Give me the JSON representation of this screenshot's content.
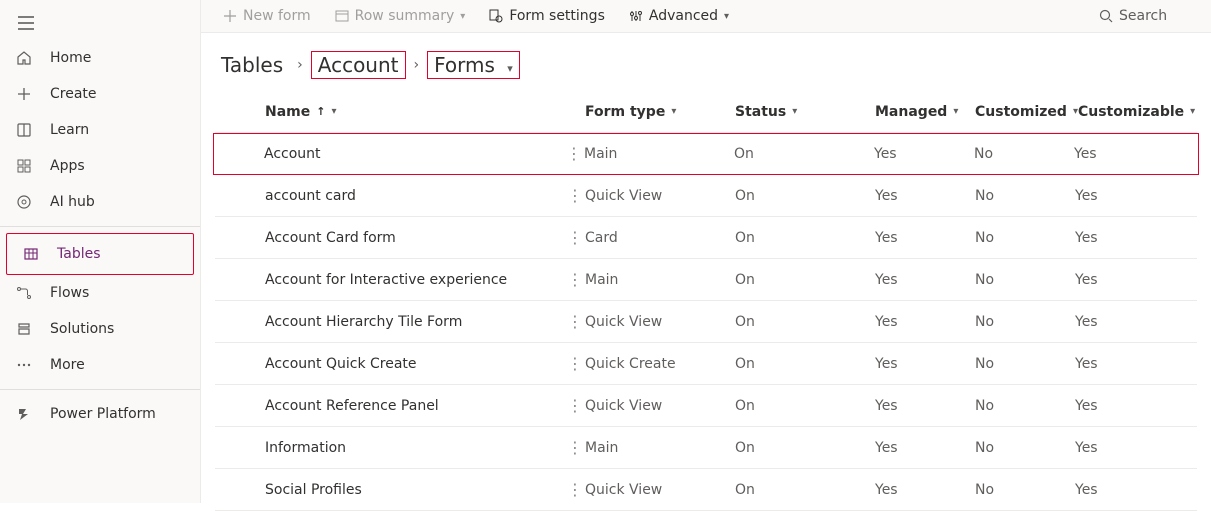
{
  "sidebar": {
    "items": [
      {
        "id": "home",
        "label": "Home"
      },
      {
        "id": "create",
        "label": "Create"
      },
      {
        "id": "learn",
        "label": "Learn"
      },
      {
        "id": "apps",
        "label": "Apps"
      },
      {
        "id": "aihub",
        "label": "AI hub"
      },
      {
        "id": "tables",
        "label": "Tables"
      },
      {
        "id": "flows",
        "label": "Flows"
      },
      {
        "id": "solutions",
        "label": "Solutions"
      },
      {
        "id": "more",
        "label": "More"
      },
      {
        "id": "powerplatform",
        "label": "Power Platform"
      }
    ]
  },
  "commandBar": {
    "newForm": "New form",
    "rowSummary": "Row summary",
    "formSettings": "Form settings",
    "advanced": "Advanced",
    "searchPlaceholder": "Search"
  },
  "breadcrumb": {
    "root": "Tables",
    "level1": "Account",
    "level2": "Forms"
  },
  "columns": {
    "name": "Name",
    "formType": "Form type",
    "status": "Status",
    "managed": "Managed",
    "customized": "Customized",
    "customizable": "Customizable"
  },
  "rows": [
    {
      "name": "Account",
      "formType": "Main",
      "status": "On",
      "managed": "Yes",
      "customized": "No",
      "customizable": "Yes",
      "highlight": true
    },
    {
      "name": "account card",
      "formType": "Quick View",
      "status": "On",
      "managed": "Yes",
      "customized": "No",
      "customizable": "Yes"
    },
    {
      "name": "Account Card form",
      "formType": "Card",
      "status": "On",
      "managed": "Yes",
      "customized": "No",
      "customizable": "Yes"
    },
    {
      "name": "Account for Interactive experience",
      "formType": "Main",
      "status": "On",
      "managed": "Yes",
      "customized": "No",
      "customizable": "Yes"
    },
    {
      "name": "Account Hierarchy Tile Form",
      "formType": "Quick View",
      "status": "On",
      "managed": "Yes",
      "customized": "No",
      "customizable": "Yes"
    },
    {
      "name": "Account Quick Create",
      "formType": "Quick Create",
      "status": "On",
      "managed": "Yes",
      "customized": "No",
      "customizable": "Yes"
    },
    {
      "name": "Account Reference Panel",
      "formType": "Quick View",
      "status": "On",
      "managed": "Yes",
      "customized": "No",
      "customizable": "Yes"
    },
    {
      "name": "Information",
      "formType": "Main",
      "status": "On",
      "managed": "Yes",
      "customized": "No",
      "customizable": "Yes"
    },
    {
      "name": "Social Profiles",
      "formType": "Quick View",
      "status": "On",
      "managed": "Yes",
      "customized": "No",
      "customizable": "Yes"
    }
  ]
}
